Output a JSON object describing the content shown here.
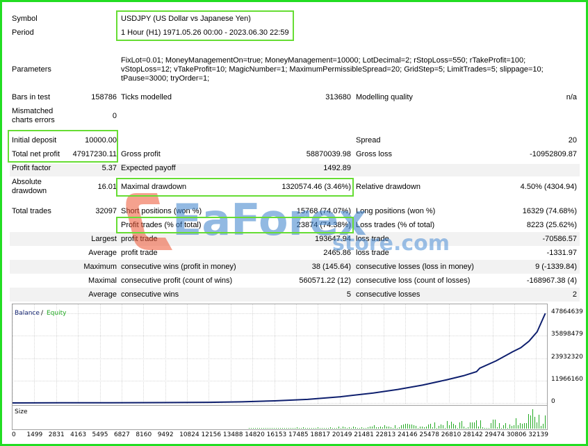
{
  "header": {
    "symbol_label": "Symbol",
    "symbol_value": "USDJPY (US Dollar vs Japanese Yen)",
    "period_label": "Period",
    "period_value": "1 Hour (H1) 1971.05.26 00:00 - 2023.06.30 22:59",
    "parameters_label": "Parameters",
    "parameters_lines": [
      "FixLot=0.01; MoneyManagementOn=true; MoneyManagement=10000; LotDecimal=2; rStopLoss=550; rTakeProfit=100;",
      "vStopLoss=12; vTakeProfit=10; MagicNumber=1; MaximumPermissibleSpread=20; GridStep=5; LimitTrades=5; slippage=10;",
      "tPause=3000; tryOrder=1;"
    ]
  },
  "stats": {
    "bars_label": "Bars in test",
    "bars_value": "158786",
    "ticks_label": "Ticks modelled",
    "ticks_value": "313680",
    "quality_label": "Modelling quality",
    "quality_value": "n/a",
    "mismatch_label_1": "Mismatched",
    "mismatch_label_2": "charts errors",
    "mismatch_value": "0",
    "deposit_label": "Initial deposit",
    "deposit_value": "10000.00",
    "spread_label": "Spread",
    "spread_value": "20",
    "netprofit_label": "Total net profit",
    "netprofit_value": "47917230.11",
    "grossprofit_label": "Gross profit",
    "grossprofit_value": "58870039.98",
    "grossloss_label": "Gross loss",
    "grossloss_value": "-10952809.87",
    "pf_label": "Profit factor",
    "pf_value": "5.37",
    "ep_label": "Expected payoff",
    "ep_value": "1492.89",
    "absdd_label_1": "Absolute",
    "absdd_label_2": "drawdown",
    "absdd_value": "16.01",
    "maxdd_label": "Maximal drawdown",
    "maxdd_value": "1320574.46 (3.46%)",
    "reldd_label": "Relative drawdown",
    "reldd_value": "4.50% (4304.94)",
    "trades_label": "Total trades",
    "trades_value": "32097",
    "short_label": "Short positions (won %)",
    "short_value": "15768 (74.07%)",
    "long_label": "Long positions (won %)",
    "long_value": "16329 (74.68%)",
    "pt_label": "Profit trades (% of total)",
    "pt_value": "23874 (74.38%)",
    "lt_label": "Loss trades (% of total)",
    "lt_value": "8223 (25.62%)",
    "largest_label": "Largest",
    "lpt_label": "profit trade",
    "lpt_value": "193647.94",
    "llt_label": "loss trade",
    "llt_value": "-70586.57",
    "average_label": "Average",
    "apt_label": "profit trade",
    "apt_value": "2465.86",
    "alt_label": "loss trade",
    "alt_value": "-1331.97",
    "maximum_label": "Maximum",
    "mcw_label": "consecutive wins (profit in money)",
    "mcw_value": "38 (145.64)",
    "mcl_label": "consecutive losses (loss in money)",
    "mcl_value": "9 (-1339.84)",
    "maximal_label": "Maximal",
    "mcp_label": "consecutive profit (count of wins)",
    "mcp_value": "560571.22 (12)",
    "mcls_label": "consecutive loss (count of losses)",
    "mcls_value": "-168967.38 (4)",
    "average2_label": "Average",
    "acw_label": "consecutive wins",
    "acw_value": "5",
    "acl_label": "consecutive losses",
    "acl_value": "2"
  },
  "watermark": {
    "brand_main": "EaForex",
    "brand_sub": "store.com"
  },
  "chart_data": {
    "type": "line",
    "title": "",
    "legend": [
      "Balance",
      "Equity"
    ],
    "legend_sep": "/",
    "size_label": "Size",
    "y_ticks": [
      "47864639",
      "35898479",
      "23932320",
      "11966160",
      "0"
    ],
    "ylim": [
      0,
      47864639
    ],
    "x_ticks": [
      "0",
      "1499",
      "2831",
      "4163",
      "5495",
      "6827",
      "8160",
      "9492",
      "10824",
      "12156",
      "13488",
      "14820",
      "16153",
      "17485",
      "18817",
      "20149",
      "21481",
      "22813",
      "24146",
      "25478",
      "26810",
      "28142",
      "29474",
      "30806",
      "32139"
    ],
    "xlim": [
      0,
      32600
    ],
    "series": [
      {
        "name": "Balance",
        "x": [
          0,
          3000,
          6000,
          9000,
          12000,
          14000,
          16000,
          18000,
          20000,
          22000,
          23500,
          25000,
          26500,
          27500,
          28300,
          28500,
          29500,
          30500,
          31000,
          31500,
          32000,
          32500
        ],
        "y": [
          10000,
          60000,
          120000,
          200000,
          350000,
          600000,
          1100000,
          1900000,
          3300000,
          5300000,
          7200000,
          9500000,
          12400000,
          14500000,
          16700000,
          18600000,
          22500000,
          27300000,
          29500000,
          33000000,
          38000000,
          47860000
        ]
      }
    ],
    "colors": {
      "balance": "#0e1f6e",
      "equity": "#22aa22",
      "size_bars": "#22aa22"
    },
    "grid": true
  }
}
